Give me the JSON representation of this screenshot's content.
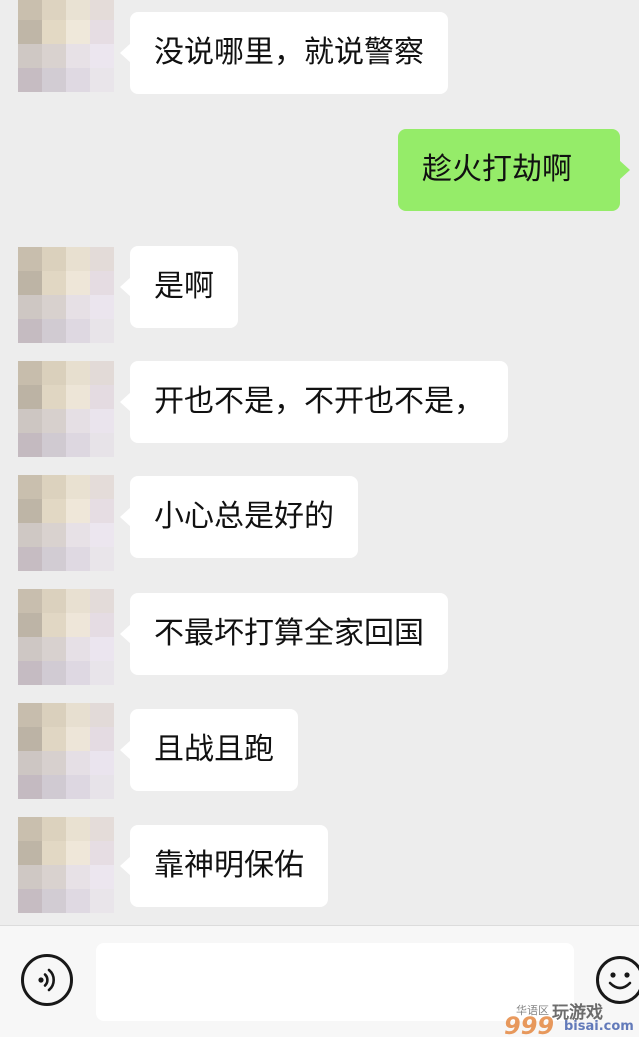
{
  "chat": {
    "messages": [
      {
        "side": "in",
        "text": "没说哪里，就说警察"
      },
      {
        "side": "out",
        "text": "趁火打劫啊"
      },
      {
        "side": "in",
        "text": "是啊"
      },
      {
        "side": "in",
        "text": "开也不是，不开也不是，"
      },
      {
        "side": "in",
        "text": "小心总是好的"
      },
      {
        "side": "in",
        "text": "不最坏打算全家回国"
      },
      {
        "side": "in",
        "text": "且战且跑"
      },
      {
        "side": "in",
        "text": "靠神明保佑"
      }
    ]
  },
  "input_bar": {
    "voice_icon": "voice-icon",
    "text_value": "",
    "emoji_icon": "emoji-icon"
  },
  "watermark": {
    "site_text": "玩游戏",
    "small_text": "华语区",
    "number_text": "999",
    "domain_text": "bisai.com"
  },
  "colors": {
    "background": "#ededed",
    "incoming_bubble": "#ffffff",
    "outgoing_bubble": "#95ec69",
    "input_bar": "#f7f7f7"
  }
}
